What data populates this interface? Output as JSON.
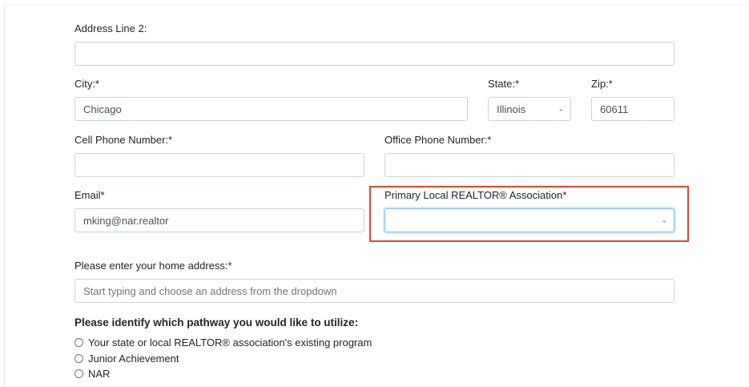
{
  "address2": {
    "label": "Address Line 2:",
    "value": ""
  },
  "city": {
    "label": "City:*",
    "value": "Chicago"
  },
  "state": {
    "label": "State:*",
    "value": "Illinois",
    "caret_icon": "chevron-down-icon"
  },
  "zip": {
    "label": "Zip:*",
    "value": "60611"
  },
  "cell_phone": {
    "label": "Cell Phone Number:*",
    "value": ""
  },
  "office_phone": {
    "label": "Office Phone Number:*",
    "value": ""
  },
  "email": {
    "label": "Email*",
    "value": "mking@nar.realtor"
  },
  "association": {
    "label": "Primary Local REALTOR® Association*",
    "value": "",
    "caret_icon": "chevron-down-icon",
    "highlight_color": "#e3442f"
  },
  "home_address": {
    "label": "Please enter your home address:*",
    "placeholder": "Start typing and choose an address from the dropdown"
  },
  "pathway": {
    "question": "Please identify which pathway you would like to utilize:",
    "options": [
      "Your state or local REALTOR® association's existing program",
      "Junior Achievement",
      "NAR"
    ]
  }
}
